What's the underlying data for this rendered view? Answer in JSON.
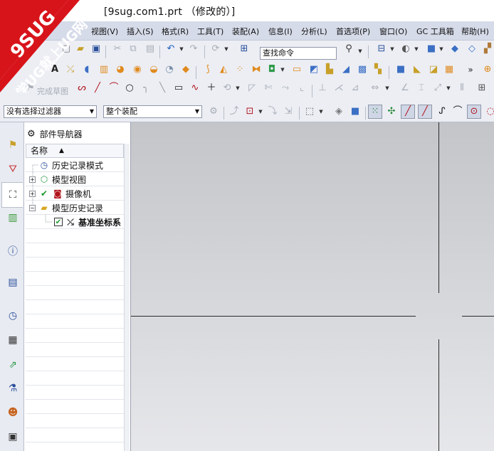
{
  "window": {
    "title": "[9sug.com1.prt （修改的）]"
  },
  "watermark": {
    "line1": "9SUG",
    "line2": "学UG就上UG网"
  },
  "menu": [
    {
      "label": "视图(V)"
    },
    {
      "label": "插入(S)"
    },
    {
      "label": "格式(R)"
    },
    {
      "label": "工具(T)"
    },
    {
      "label": "装配(A)"
    },
    {
      "label": "信息(I)"
    },
    {
      "label": "分析(L)"
    },
    {
      "label": "首选项(P)"
    },
    {
      "label": "窗口(O)"
    },
    {
      "label": "GC 工具箱"
    },
    {
      "label": "帮助(H)"
    }
  ],
  "toolbar": {
    "search_command": "查找命令",
    "finish_sketch": "完成草图",
    "selection_filter": "没有选择过滤器",
    "scope": "整个装配"
  },
  "navigator": {
    "title": "部件导航器",
    "column_name": "名称",
    "items": [
      {
        "label": "历史记录模式"
      },
      {
        "label": "模型视图"
      },
      {
        "label": "摄像机"
      },
      {
        "label": "模型历史记录"
      },
      {
        "label": "基准坐标系"
      }
    ]
  }
}
